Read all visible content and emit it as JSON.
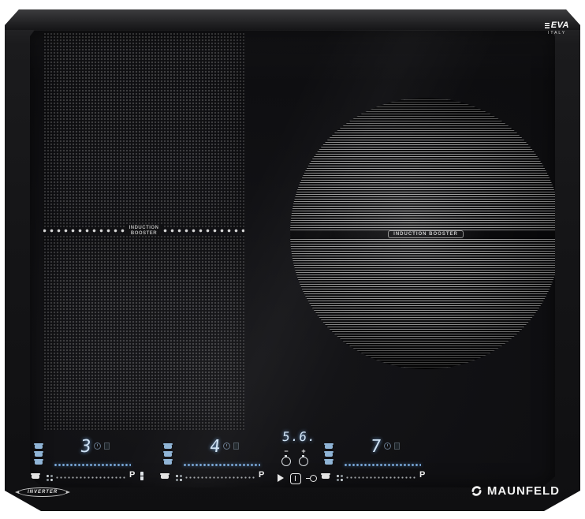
{
  "brand": {
    "logo_text": "EVA",
    "logo_subtext": "ITALY",
    "manufacturer": "MAUNFELD",
    "badge": "INVERTER"
  },
  "zones": {
    "left_separator_label": {
      "line1": "INDUCTION",
      "line2": "BOOSTER"
    },
    "right_center_label": "INDUCTION BOOSTER"
  },
  "controls": {
    "zone_a": {
      "level": "3",
      "boost": "P"
    },
    "zone_b": {
      "level": "4",
      "boost": "P"
    },
    "zone_c": {
      "level": "7",
      "boost": "P"
    },
    "timer": {
      "value": "5.6.",
      "minus": "−",
      "plus": "+"
    }
  },
  "colors": {
    "display_blue": "#cfe2f4",
    "slider_blue": "#6f9fd2",
    "glass_black": "#0e0e10",
    "body_black": "#161618"
  }
}
